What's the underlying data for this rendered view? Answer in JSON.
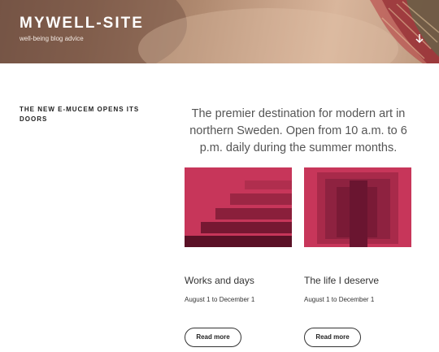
{
  "site": {
    "title": "MYWELL-SITE",
    "tagline": "well-being blog advice"
  },
  "icons": {
    "scroll": "arrow-down-icon"
  },
  "colors": {
    "accent": "#c7365a",
    "dark_accent": "#7a1530",
    "text": "#333333"
  },
  "section": {
    "title": "THE NEW E-MUCEM OPENS ITS DOORS",
    "intro": "The premier destination for modern art in northern Sweden. Open from 10 a.m. to 6 p.m. daily during the summer months."
  },
  "cards": [
    {
      "title": "Works and days",
      "date": "August 1 to December 1",
      "button": "Read more"
    },
    {
      "title": "The life I deserve",
      "date": "August 1 to December 1",
      "button": "Read more"
    }
  ]
}
